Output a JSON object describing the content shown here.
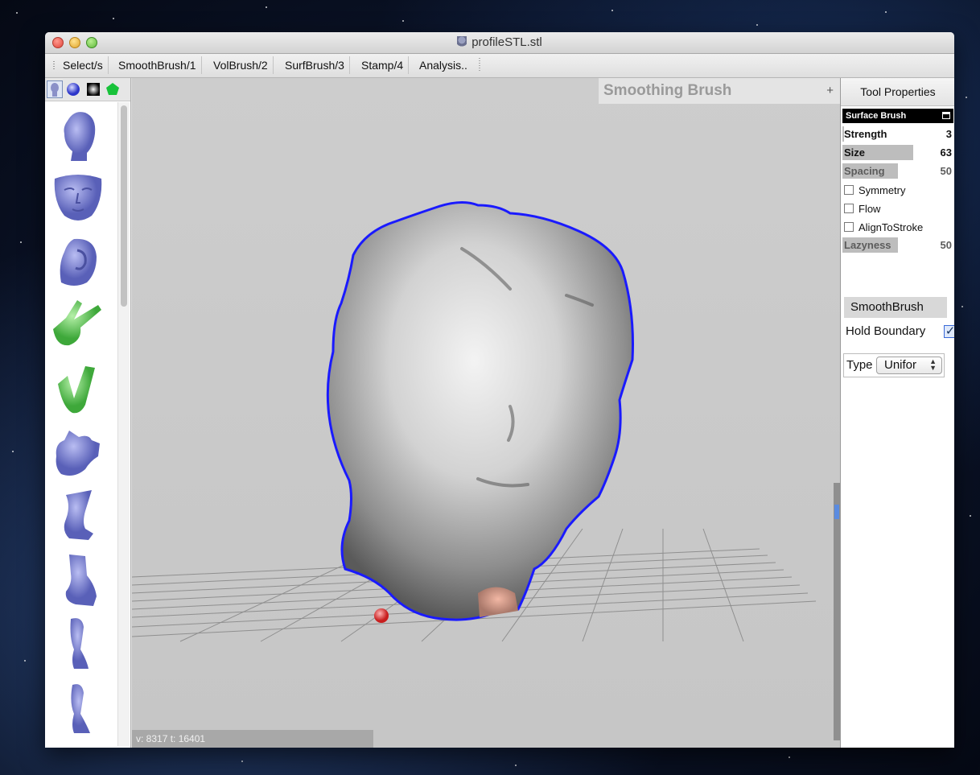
{
  "window": {
    "title": "profileSTL.stl"
  },
  "toolbar": {
    "buttons": [
      "Select/s",
      "SmoothBrush/1",
      "VolBrush/2",
      "SurfBrush/3",
      "Stamp/4",
      "Analysis.."
    ]
  },
  "library": {
    "tabs": [
      "mesh-library-tab",
      "sphere-tab",
      "gradient-tab",
      "pentagon-tab"
    ],
    "active_tab": 0,
    "items": [
      "head-model",
      "face-model",
      "ear-model",
      "hand-model",
      "arm-model",
      "blob-model",
      "leg-model",
      "leg-model-2",
      "foot-model",
      "foot-model-2"
    ]
  },
  "viewport": {
    "hud_title": "Smoothing Brush",
    "hud_plus": "+",
    "status": "v: 8317 t: 16401"
  },
  "panel": {
    "header": "Tool Properties",
    "section": "Surface Brush",
    "strength_label": "Strength",
    "strength_value": "3",
    "size_label": "Size",
    "size_value": "63",
    "spacing_label": "Spacing",
    "spacing_value": "50",
    "symmetry_label": "Symmetry",
    "flow_label": "Flow",
    "align_label": "AlignToStroke",
    "lazyness_label": "Lazyness",
    "lazyness_value": "50",
    "smooth_button": "SmoothBrush",
    "hold_boundary_label": "Hold Boundary",
    "hold_boundary_checked": true,
    "type_label": "Type",
    "type_value": "Unifor"
  },
  "colors": {
    "accent_outline": "#1a1aff",
    "library_blue": "#7b83d6",
    "library_green": "#5fcf59"
  }
}
